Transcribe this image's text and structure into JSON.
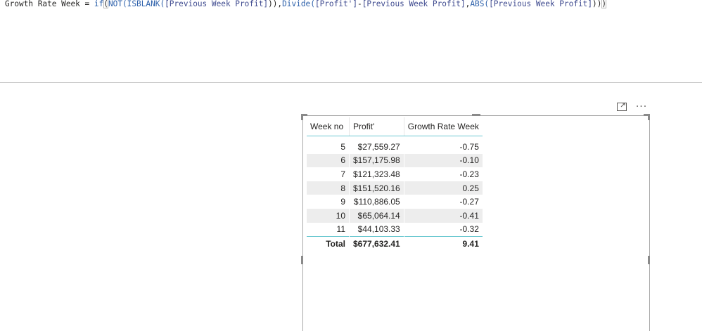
{
  "formula": {
    "measure_name": "Growth Rate Week",
    "operator": " = ",
    "fn_if": "if",
    "open_paren_hl": "(",
    "fn_not": "NOT(ISBLANK(",
    "ref1": "[Previous Week Profit]",
    "part2": ")),",
    "fn_divide": "Divide(",
    "ref2": "[Profit']",
    "minus": "-",
    "ref3": "[Previous Week Profit]",
    "comma": ",",
    "fn_abs": "ABS(",
    "ref4": "[Previous Week Profit]",
    "close_parens": "))",
    "close_paren_hl": ")"
  },
  "visual_header": {
    "focus_icon": "focus-mode-icon",
    "more_label": "···"
  },
  "table": {
    "headers": [
      "Week no",
      "Profit'",
      "Growth Rate Week"
    ],
    "rows": [
      {
        "week": "5",
        "profit": "$27,559.27",
        "growth": "-0.75"
      },
      {
        "week": "6",
        "profit": "$157,175.98",
        "growth": "-0.10"
      },
      {
        "week": "7",
        "profit": "$121,323.48",
        "growth": "-0.23"
      },
      {
        "week": "8",
        "profit": "$151,520.16",
        "growth": "0.25"
      },
      {
        "week": "9",
        "profit": "$110,886.05",
        "growth": "-0.27"
      },
      {
        "week": "10",
        "profit": "$65,064.14",
        "growth": "-0.41"
      },
      {
        "week": "11",
        "profit": "$44,103.33",
        "growth": "-0.32"
      }
    ],
    "total": {
      "label": "Total",
      "profit": "$677,632.41",
      "growth": "9.41"
    }
  },
  "colors": {
    "header_rule": "#6bc8d1",
    "alt_row": "#ededed"
  }
}
